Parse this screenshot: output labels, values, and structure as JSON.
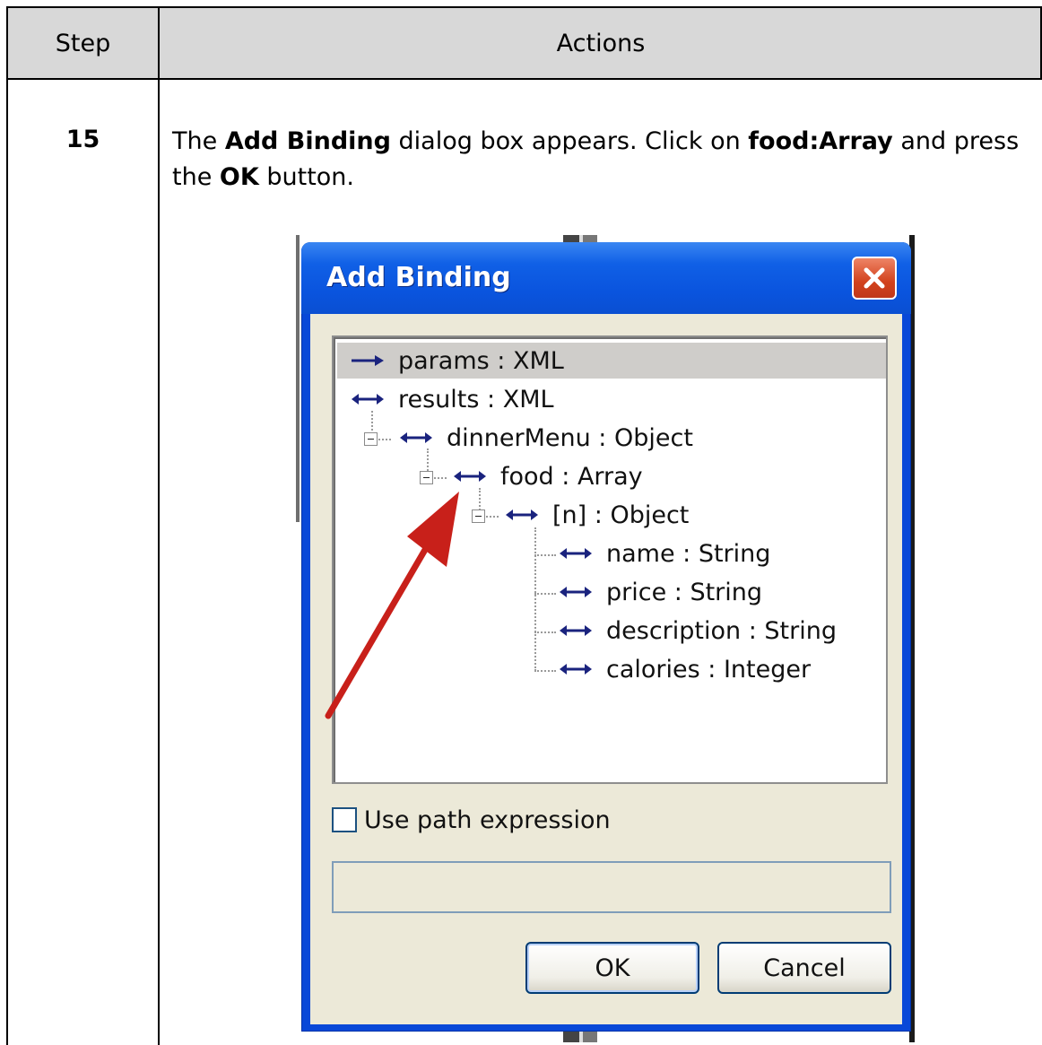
{
  "table": {
    "header_step": "Step",
    "header_actions": "Actions",
    "step_number": "15",
    "instruction": {
      "part1": "The ",
      "bold1": "Add Binding",
      "part2": " dialog box appears. Click on ",
      "bold2": "food:Array",
      "part3": " and press the ",
      "bold3": "OK",
      "part4": " button."
    }
  },
  "dialog": {
    "title": "Add Binding",
    "tree": [
      {
        "label": "params : XML",
        "arrow": "right-arrow-icon",
        "selected": true
      },
      {
        "label": "results : XML",
        "arrow": "double-arrow-icon"
      },
      {
        "label": "dinnerMenu : Object",
        "arrow": "double-arrow-icon"
      },
      {
        "label": "food : Array",
        "arrow": "double-arrow-icon"
      },
      {
        "label": "[n] : Object",
        "arrow": "double-arrow-icon"
      },
      {
        "label": "name : String",
        "arrow": "double-arrow-icon"
      },
      {
        "label": "price : String",
        "arrow": "double-arrow-icon"
      },
      {
        "label": "description : String",
        "arrow": "double-arrow-icon"
      },
      {
        "label": "calories : Integer",
        "arrow": "double-arrow-icon"
      }
    ],
    "checkbox_label": "Use path expression",
    "checkbox_checked": false,
    "path_value": "",
    "ok_label": "OK",
    "cancel_label": "Cancel",
    "annotation_color": "#c8201a"
  }
}
